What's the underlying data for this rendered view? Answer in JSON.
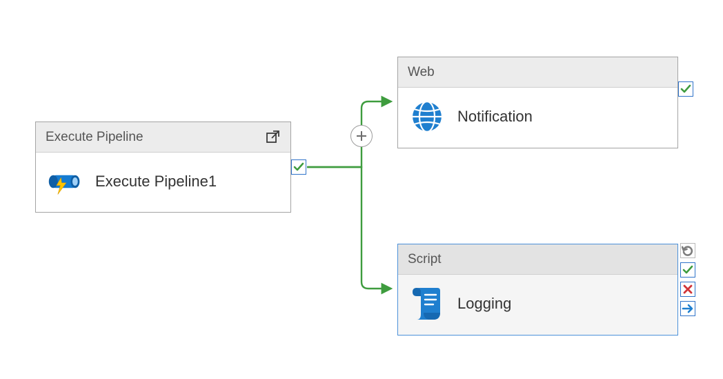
{
  "nodes": {
    "execute_pipeline": {
      "type_label": "Execute Pipeline",
      "name": "Execute Pipeline1"
    },
    "web": {
      "type_label": "Web",
      "name": "Notification"
    },
    "script": {
      "type_label": "Script",
      "name": "Logging"
    }
  },
  "badges": {
    "success": "success",
    "failure": "failure",
    "completion": "completion",
    "skip": "skip"
  },
  "colors": {
    "connector_green": "#3e9c3e",
    "accent_blue": "#157bd1",
    "border_gray": "#a3a3a3",
    "icon_yellow": "#ffc400",
    "error_red": "#d13438"
  }
}
